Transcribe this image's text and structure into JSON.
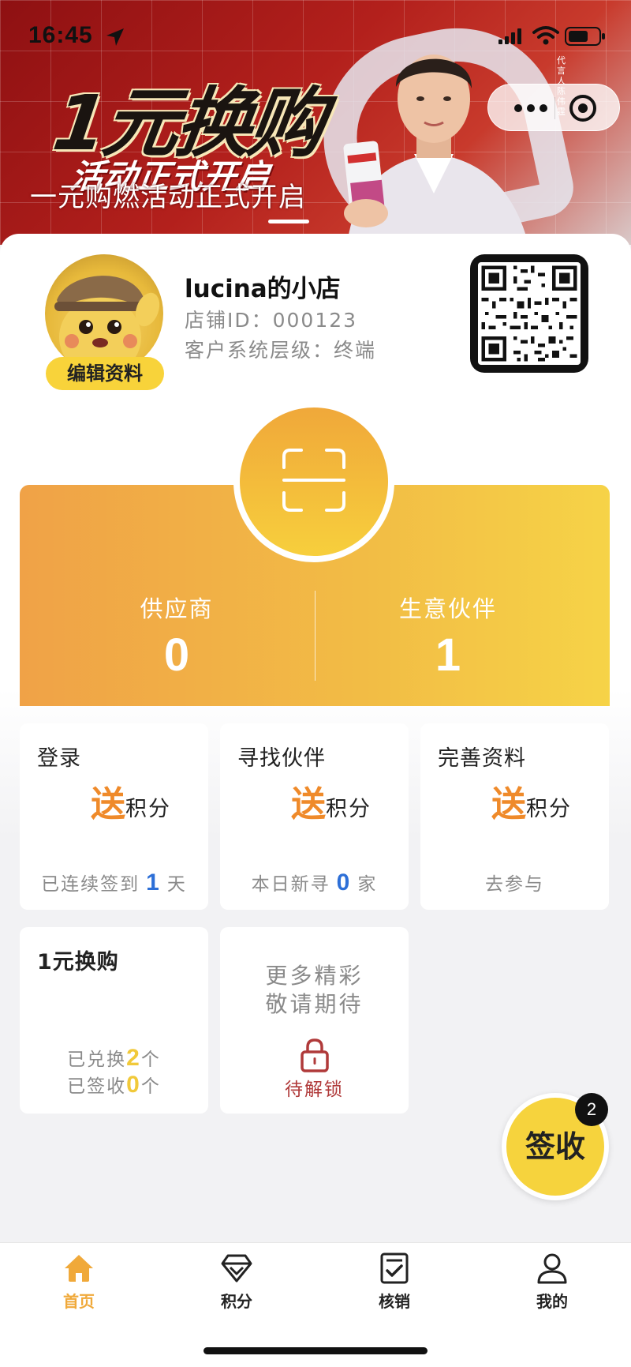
{
  "status_bar": {
    "time": "16:45"
  },
  "banner": {
    "title": "1元换购",
    "subtitle_1": "活动正式开启",
    "subtitle_2": "一元购燃活动正式开启",
    "endorser_caption": "代言人 陈伟霆"
  },
  "shop": {
    "name": "lucina的小店",
    "id_text": "店铺ID：000123",
    "level_text": "客户系统层级：终端",
    "edit_label": "编辑资料"
  },
  "stats": {
    "supplier_label": "供应商",
    "supplier_value": "0",
    "partner_label": "生意伙伴",
    "partner_value": "1"
  },
  "tiles": {
    "login": {
      "title": "登录",
      "reward_big": "送",
      "reward_small": "积分",
      "foot_pre": "已连续签到",
      "foot_num": "1",
      "foot_post": "天"
    },
    "find": {
      "title": "寻找伙伴",
      "reward_big": "送",
      "reward_small": "积分",
      "foot_pre": "本日新寻",
      "foot_num": "0",
      "foot_post": "家"
    },
    "profile": {
      "title": "完善资料",
      "reward_big": "送",
      "reward_small": "积分",
      "foot": "去参与"
    },
    "exchange": {
      "title": "1元换购",
      "line1_pre": "已兑换",
      "line1_num": "2",
      "line1_post": "个",
      "line2_pre": "已签收",
      "line2_num": "0",
      "line2_post": "个"
    },
    "more": {
      "line1": "更多精彩",
      "line2": "敬请期待",
      "locked_label": "待解锁"
    }
  },
  "sign": {
    "label": "签收",
    "badge": "2"
  },
  "tabbar": {
    "tabs": [
      {
        "label": "首页",
        "icon": "home-icon",
        "active": true
      },
      {
        "label": "积分",
        "icon": "diamond-icon",
        "active": false
      },
      {
        "label": "核销",
        "icon": "checklist-icon",
        "active": false
      },
      {
        "label": "我的",
        "icon": "person-icon",
        "active": false
      }
    ]
  },
  "colors": {
    "accent_orange": "#ef8a2a",
    "accent_yellow": "#f6d33d",
    "active_tab": "#f0a93a",
    "count_blue": "#2d6fd7",
    "lock_red": "#b03a3a"
  }
}
